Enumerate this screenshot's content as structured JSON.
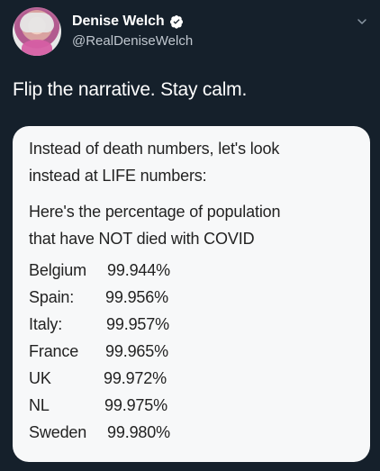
{
  "profile": {
    "name": "Denise Welch",
    "handle": "@RealDeniseWelch",
    "avatar_icon": "profile-photo-icon",
    "verified_icon": "verified-badge-icon",
    "menu_icon": "chevron-down-icon"
  },
  "tweet": {
    "text": "Flip the narrative. Stay calm."
  },
  "card": {
    "intro_line_1": "Instead of death numbers, let's look",
    "intro_line_2": "instead at LIFE numbers:",
    "subtitle_line_1": "Here's the percentage of population",
    "subtitle_line_2": "that have NOT died with COVID",
    "rows": [
      {
        "country": "Belgium",
        "value": "99.944%"
      },
      {
        "country": "Spain:",
        "value": "99.956%"
      },
      {
        "country": "Italy:",
        "value": "99.957%"
      },
      {
        "country": "France",
        "value": "99.965%"
      },
      {
        "country": "UK",
        "value": "99.972%"
      },
      {
        "country": "NL",
        "value": "99.975%"
      },
      {
        "country": "Sweden",
        "value": "99.980%"
      }
    ]
  },
  "colors": {
    "background": "#15202b",
    "card": "#f7f8f9",
    "text_primary": "#ffffff",
    "text_secondary": "#c0c7cf",
    "card_text": "#222222",
    "verified": "#ffffff"
  }
}
